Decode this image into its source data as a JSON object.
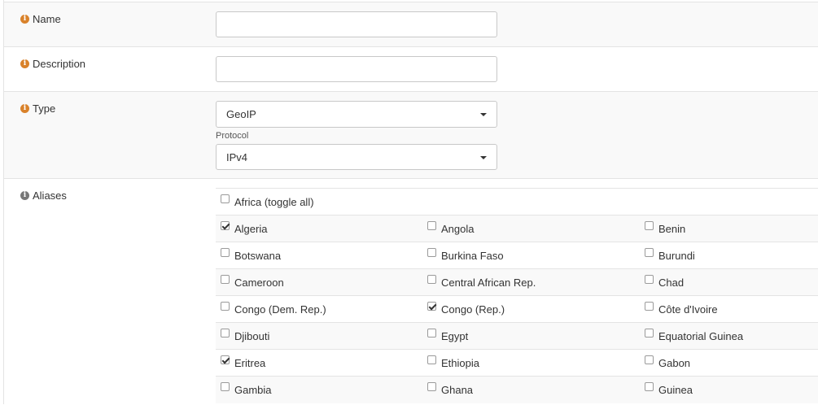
{
  "form": {
    "name": {
      "label": "Name",
      "value": ""
    },
    "description": {
      "label": "Description",
      "value": ""
    },
    "type": {
      "label": "Type",
      "selected": "GeoIP"
    },
    "protocol": {
      "label": "Protocol",
      "selected": "IPv4"
    },
    "aliases": {
      "label": "Aliases",
      "toggle_all": {
        "label": "Africa (toggle all)",
        "checked": false
      },
      "rows": [
        [
          {
            "label": "Algeria",
            "checked": true
          },
          {
            "label": "Angola",
            "checked": false
          },
          {
            "label": "Benin",
            "checked": false
          }
        ],
        [
          {
            "label": "Botswana",
            "checked": false
          },
          {
            "label": "Burkina Faso",
            "checked": false
          },
          {
            "label": "Burundi",
            "checked": false
          }
        ],
        [
          {
            "label": "Cameroon",
            "checked": false
          },
          {
            "label": "Central African Rep.",
            "checked": false
          },
          {
            "label": "Chad",
            "checked": false
          }
        ],
        [
          {
            "label": "Congo (Dem. Rep.)",
            "checked": false
          },
          {
            "label": "Congo (Rep.)",
            "checked": true
          },
          {
            "label": "Côte d'Ivoire",
            "checked": false
          }
        ],
        [
          {
            "label": "Djibouti",
            "checked": false
          },
          {
            "label": "Egypt",
            "checked": false
          },
          {
            "label": "Equatorial Guinea",
            "checked": false
          }
        ],
        [
          {
            "label": "Eritrea",
            "checked": true
          },
          {
            "label": "Ethiopia",
            "checked": false
          },
          {
            "label": "Gabon",
            "checked": false
          }
        ],
        [
          {
            "label": "Gambia",
            "checked": false
          },
          {
            "label": "Ghana",
            "checked": false
          },
          {
            "label": "Guinea",
            "checked": false
          }
        ]
      ]
    }
  }
}
